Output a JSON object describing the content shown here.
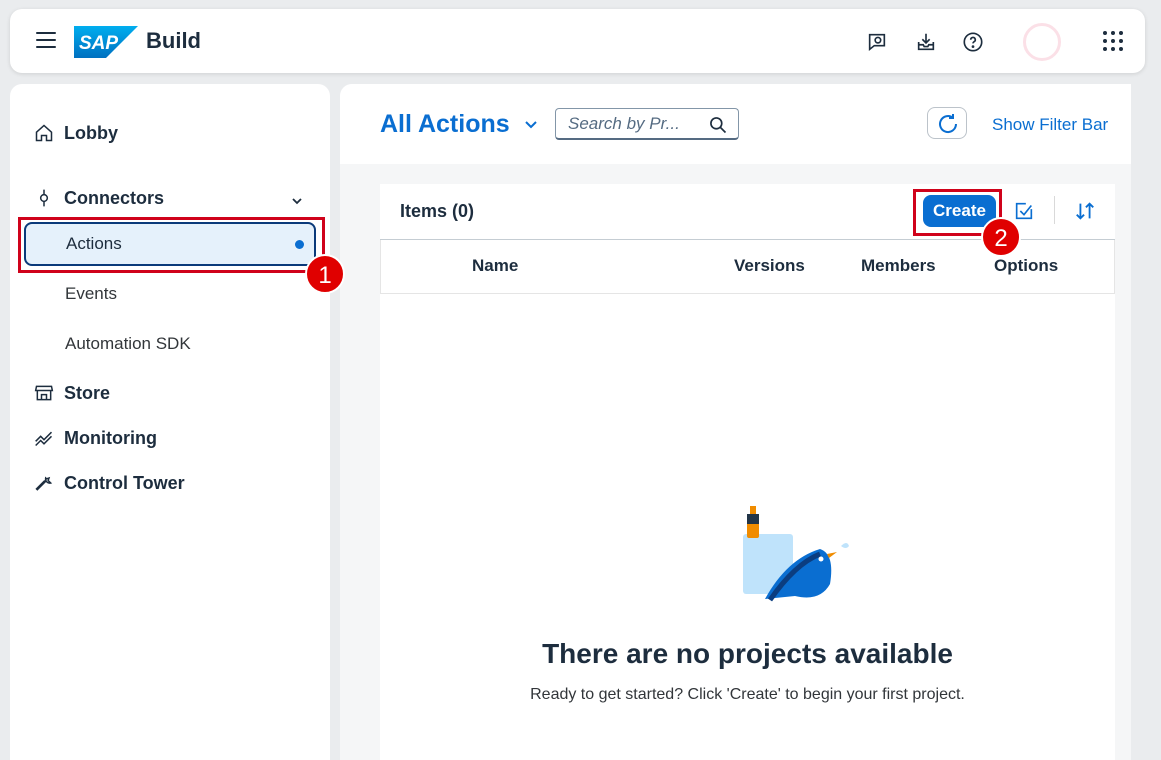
{
  "shell": {
    "brand_logo": "SAP",
    "product_name": "Build",
    "icons": [
      "hamburger-menu-icon",
      "feedback-icon",
      "download-inbox-icon",
      "help-icon",
      "avatar",
      "app-grid-icon"
    ]
  },
  "sidebar": {
    "items": [
      {
        "label": "Lobby",
        "icon": "home-icon"
      },
      {
        "label": "Connectors",
        "icon": "connector-icon"
      },
      {
        "label": "Actions"
      },
      {
        "label": "Events"
      },
      {
        "label": "Automation SDK"
      },
      {
        "label": "Store",
        "icon": "store-icon"
      },
      {
        "label": "Monitoring",
        "icon": "monitoring-icon"
      },
      {
        "label": "Control Tower",
        "icon": "wrench-icon"
      }
    ]
  },
  "main": {
    "view_title": "All Actions",
    "search_placeholder": "Search by Pr...",
    "filter_link": "Show Filter Bar",
    "table": {
      "title": "Items (0)",
      "create_label": "Create",
      "columns": [
        "Name",
        "Versions",
        "Members",
        "Options"
      ]
    },
    "empty_state": {
      "title": "There are no projects available",
      "description": "Ready to get started? Click 'Create' to begin your first project."
    }
  },
  "annotations": {
    "step1": "1",
    "step2": "2",
    "color": "#d0021b"
  },
  "colors": {
    "accent": "#0a6ed1",
    "text": "#1d2d3e"
  }
}
